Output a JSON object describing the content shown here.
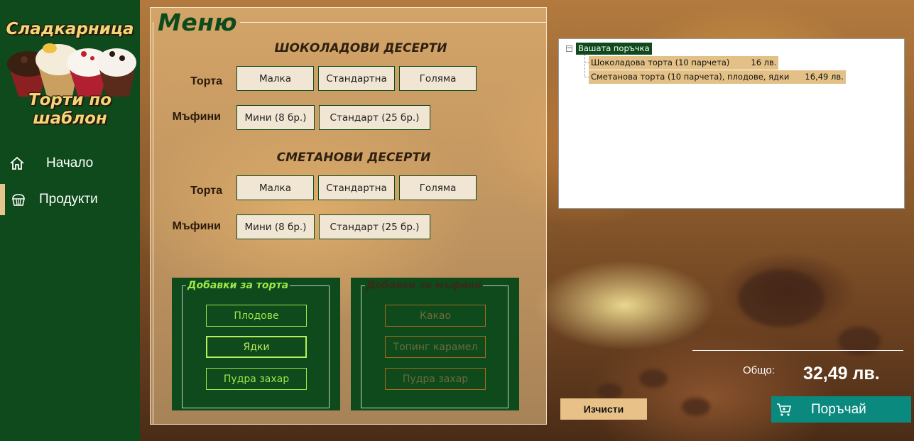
{
  "app": {
    "logo_top": "Сладкарница",
    "logo_bottom": "Торти по шаблон"
  },
  "sidebar": {
    "items": [
      {
        "label": "Начало",
        "icon": "home-icon",
        "active": false
      },
      {
        "label": "Продукти",
        "icon": "cupcake-icon",
        "active": true
      }
    ]
  },
  "menu": {
    "title": "Меню",
    "sections": [
      {
        "heading": "ШОКОЛАДОВИ ДЕСЕРТИ",
        "cake_label": "Торта",
        "cake_options": [
          "Малка",
          "Стандартна",
          "Голяма"
        ],
        "muffin_label": "Мъфини",
        "muffin_options": [
          "Мини (8 бр.)",
          "Стандарт (25 бр.)"
        ]
      },
      {
        "heading": "СМЕТАНОВИ ДЕСЕРТИ",
        "cake_label": "Торта",
        "cake_options": [
          "Малка",
          "Стандартна",
          "Голяма"
        ],
        "muffin_label": "Мъфини",
        "muffin_options": [
          "Мини (8 бр.)",
          "Стандарт (25 бр.)"
        ]
      }
    ],
    "cake_addons": {
      "legend": "Добавки за торта",
      "options": [
        "Плодове",
        "Ядки",
        "Пудра захар"
      ],
      "selected": "Ядки",
      "enabled": true
    },
    "muffin_addons": {
      "legend": "Добавки за мъфини",
      "options": [
        "Какао",
        "Топинг карамел",
        "Пудра захар"
      ],
      "enabled": false
    }
  },
  "order": {
    "root_label": "Вашата поръчка",
    "items": [
      {
        "name": "Шоколадова торта (10 парчета)",
        "price": "16 лв."
      },
      {
        "name": "Сметанова торта (10 парчета), плодове, ядки",
        "price": "16,49 лв."
      }
    ],
    "total_label": "Общо:",
    "total_value": "32,49 лв.",
    "clear_label": "Изчисти",
    "submit_label": "Поръчай"
  },
  "colors": {
    "sidebar": "#0e4a1c",
    "accent_tan": "#e8c188",
    "order_button": "#0a8a7e",
    "addon_active": "#9be84a"
  }
}
